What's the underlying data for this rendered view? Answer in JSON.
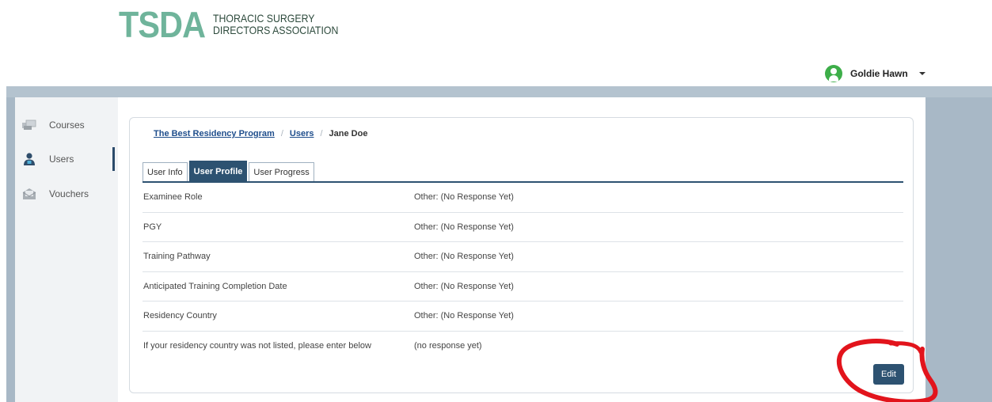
{
  "header": {
    "logo_mark": "TSDA",
    "logo_line1": "THORACIC SURGERY",
    "logo_line2": "DIRECTORS ASSOCIATION",
    "user_name": "Goldie Hawn"
  },
  "sidebar": {
    "items": [
      {
        "label": "Courses",
        "icon": "courses-icon"
      },
      {
        "label": "Users",
        "icon": "user-icon",
        "active": true
      },
      {
        "label": "Vouchers",
        "icon": "voucher-icon"
      }
    ]
  },
  "breadcrumb": {
    "program": "The Best Residency Program",
    "users": "Users",
    "separator": "/",
    "current": "Jane Doe"
  },
  "tabs": [
    {
      "label": "User Info"
    },
    {
      "label": "User Profile",
      "active": true
    },
    {
      "label": "User Progress"
    }
  ],
  "profile_rows": [
    {
      "label": "Examinee Role",
      "value": "Other: (No Response Yet)"
    },
    {
      "label": "PGY",
      "value": "Other: (No Response Yet)"
    },
    {
      "label": "Training Pathway",
      "value": "Other: (No Response Yet)"
    },
    {
      "label": "Anticipated Training Completion Date",
      "value": "Other: (No Response Yet)"
    },
    {
      "label": "Residency Country",
      "value": "Other: (No Response Yet)"
    },
    {
      "label": "If your residency country was not listed, please enter below",
      "value": "(no response yet)"
    }
  ],
  "actions": {
    "edit_label": "Edit"
  },
  "colors": {
    "brand_green": "#6fb49b",
    "primary_navy": "#2d5271",
    "link_blue": "#1f4e8c",
    "band_blue": "#a8b8c6",
    "annotation_red": "#e2141c"
  }
}
